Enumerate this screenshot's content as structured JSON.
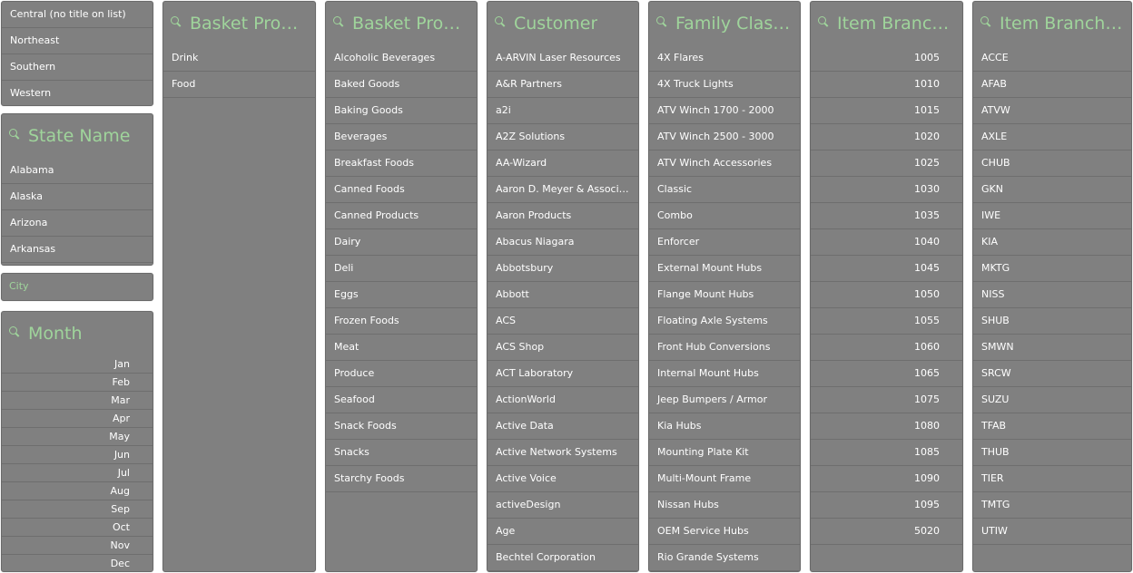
{
  "region_list": {
    "items": [
      "Central (no title on list)",
      "Northeast",
      "Southern",
      "Western"
    ]
  },
  "state_panel": {
    "title": "State Name",
    "items": [
      "Alabama",
      "Alaska",
      "Arizona",
      "Arkansas"
    ]
  },
  "city_panel": {
    "placeholder": "City"
  },
  "month_panel": {
    "title": "Month",
    "items": [
      "Jan",
      "Feb",
      "Mar",
      "Apr",
      "May",
      "Jun",
      "Jul",
      "Aug",
      "Sep",
      "Oct",
      "Nov",
      "Dec"
    ]
  },
  "basket_product_1": {
    "title": "Basket Product ...",
    "items": [
      "Drink",
      "Food"
    ]
  },
  "basket_product_2": {
    "title": "Basket Product ...",
    "items": [
      "Alcoholic Beverages",
      "Baked Goods",
      "Baking Goods",
      "Beverages",
      "Breakfast Foods",
      "Canned Foods",
      "Canned Products",
      "Dairy",
      "Deli",
      "Eggs",
      "Frozen Foods",
      "Meat",
      "Produce",
      "Seafood",
      "Snack Foods",
      "Snacks",
      "Starchy Foods"
    ]
  },
  "customer": {
    "title": "Customer",
    "items": [
      "A-ARVIN Laser Resources",
      "A&R Partners",
      "a2i",
      "A2Z Solutions",
      "AA-Wizard",
      "Aaron D. Meyer & Associates",
      "Aaron Products",
      "Abacus Niagara",
      "Abbotsbury",
      "Abbott",
      "ACS",
      "ACS Shop",
      "ACT Laboratory",
      "ActionWorld",
      "Active Data",
      "Active Network Systems",
      "Active Voice",
      "activeDesign",
      "Age",
      "Bechtel Corporation"
    ]
  },
  "family_class": {
    "title": "Family Class ...",
    "items": [
      "4X Flares",
      "4X Truck Lights",
      "ATV Winch 1700 - 2000",
      "ATV Winch 2500 - 3000",
      "ATV Winch Accessories",
      "Classic",
      "Combo",
      "Enforcer",
      "External Mount Hubs",
      "Flange Mount Hubs",
      "Floating Axle Systems",
      "Front Hub Conversions",
      "Internal Mount Hubs",
      "Jeep Bumpers / Armor",
      "Kia Hubs",
      "Mounting Plate Kit",
      "Multi-Mount Frame",
      "Nissan Hubs",
      "OEM Service Hubs",
      "Rio Grande Systems"
    ]
  },
  "item_branch": {
    "title": "Item Branch ...",
    "items": [
      "1005",
      "1010",
      "1015",
      "1020",
      "1025",
      "1030",
      "1035",
      "1040",
      "1045",
      "1050",
      "1055",
      "1060",
      "1065",
      "1075",
      "1080",
      "1085",
      "1090",
      "1095",
      "5020"
    ]
  },
  "item_branch_group": {
    "title": "Item Branch G...",
    "items": [
      "ACCE",
      "AFAB",
      "ATVW",
      "AXLE",
      "CHUB",
      "GKN",
      "IWE",
      "KIA",
      "MKTG",
      "NISS",
      "SHUB",
      "SMWN",
      "SRCW",
      "SUZU",
      "TFAB",
      "THUB",
      "TIER",
      "TMTG",
      "UTIW"
    ]
  },
  "colors": {
    "panel_bg": "#808080",
    "title_accent": "#9fd49b",
    "row_text": "#ffffff",
    "divider": "#6e6e6e"
  }
}
